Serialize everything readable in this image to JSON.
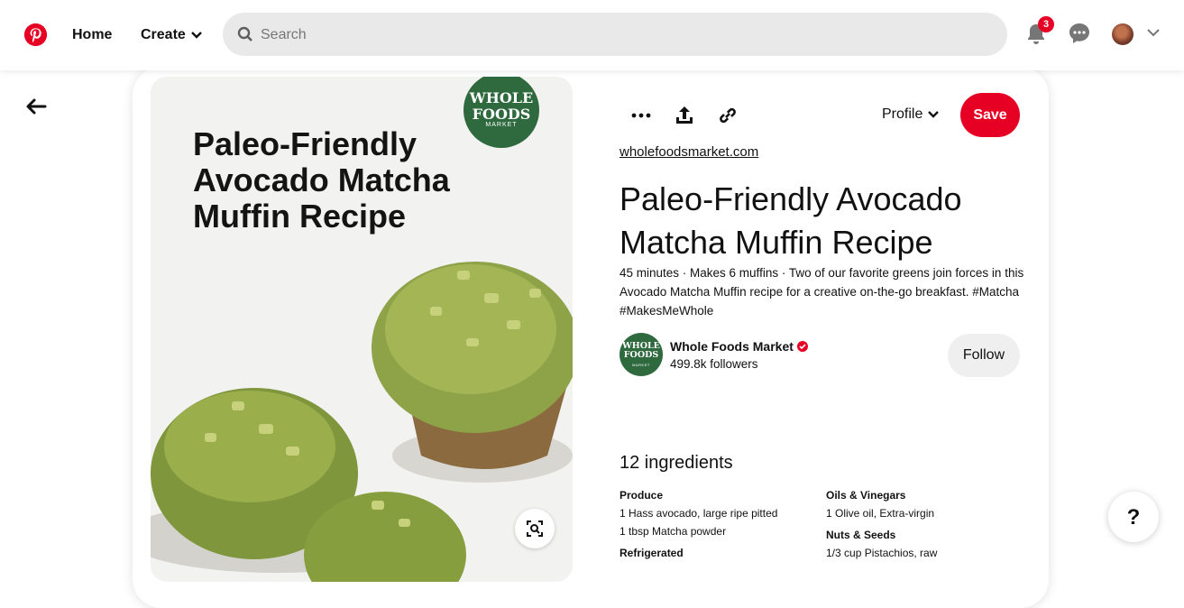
{
  "nav": {
    "home_label": "Home",
    "create_label": "Create",
    "search_placeholder": "Search",
    "notification_count": "3"
  },
  "pin": {
    "image_title": "Paleo-Friendly Avocado Matcha Muffin Recipe",
    "brand_badge_line1": "WHOLE FOODS",
    "brand_badge_line2": "MARKET",
    "profile_label": "Profile",
    "save_label": "Save",
    "source": "wholefoodsmarket.com",
    "title": "Paleo-Friendly Avocado Matcha Muffin Recipe",
    "description": "45 minutes · Makes 6 muffins · Two of our favorite greens join forces in this Avocado Matcha Muffin recipe for a creative on-the-go breakfast. #Matcha #MakesMeWhole",
    "creator_name": "Whole Foods Market",
    "creator_followers": "499.8k followers",
    "follow_label": "Follow"
  },
  "ingredients": {
    "heading": "12 ingredients",
    "columns": [
      {
        "groups": [
          {
            "category": "Produce",
            "items": [
              "1 Hass avocado, large ripe pitted",
              "1 tbsp Matcha powder"
            ]
          },
          {
            "category": "Refrigerated",
            "items": []
          }
        ]
      },
      {
        "groups": [
          {
            "category": "Oils & Vinegars",
            "items": [
              "1 Olive oil, Extra-virgin"
            ]
          },
          {
            "category": "Nuts & Seeds",
            "items": [
              "1/3 cup Pistachios, raw"
            ]
          }
        ]
      }
    ]
  },
  "help_label": "?",
  "colors": {
    "brand_red": "#e60023",
    "wfm_green": "#2f6a3f"
  }
}
